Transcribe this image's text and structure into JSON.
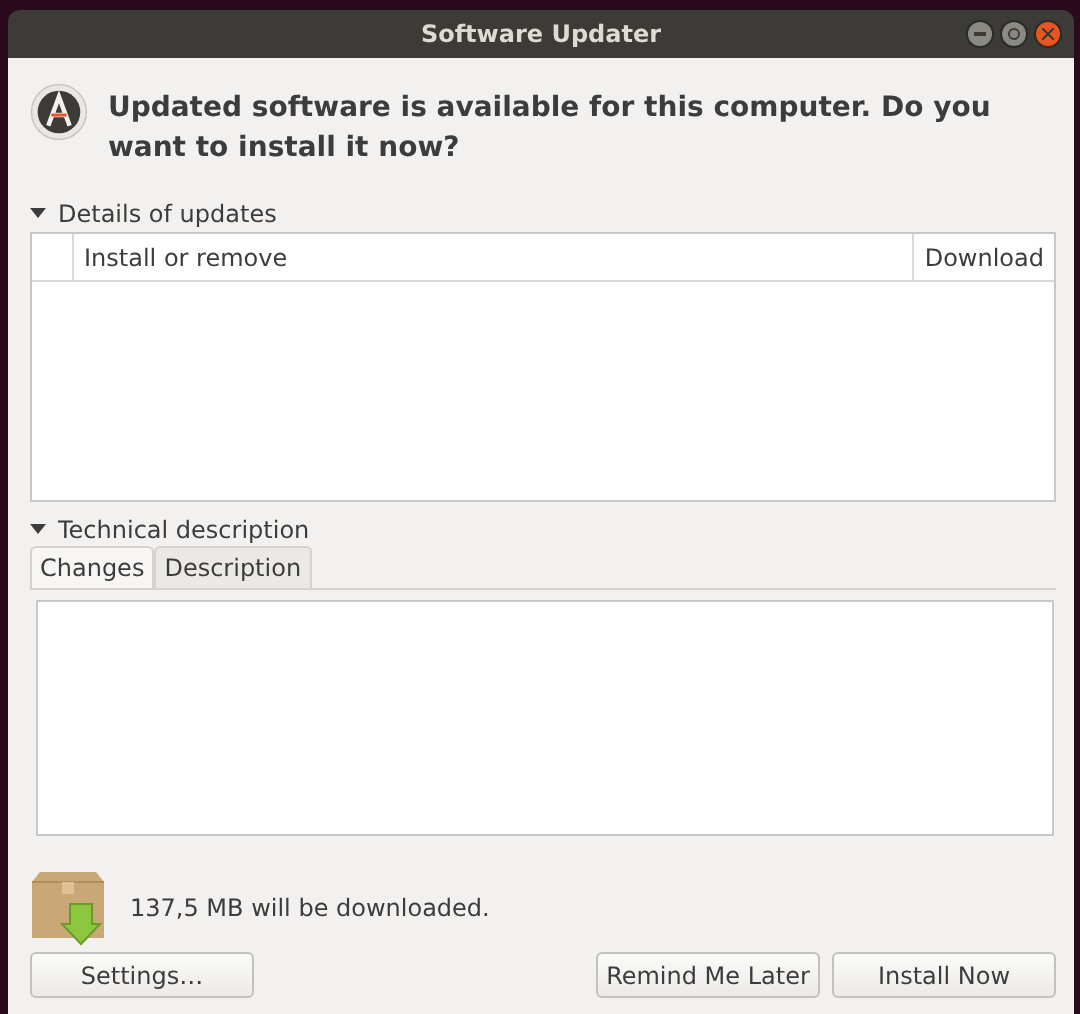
{
  "window": {
    "title": "Software Updater"
  },
  "heading": "Updated software is available for this computer. Do you want to install it now?",
  "details": {
    "label": "Details of updates",
    "expanded": true,
    "columns": [
      "Install or remove",
      "Download"
    ]
  },
  "technical": {
    "label": "Technical description",
    "expanded": true,
    "tabs": [
      {
        "label": "Changes",
        "selected": true
      },
      {
        "label": "Description",
        "selected": false
      }
    ]
  },
  "download_size": "137,5 MB will be downloaded.",
  "buttons": {
    "left": [
      "Settings…"
    ],
    "right": [
      "Remind Me Later",
      "Install Now"
    ]
  }
}
